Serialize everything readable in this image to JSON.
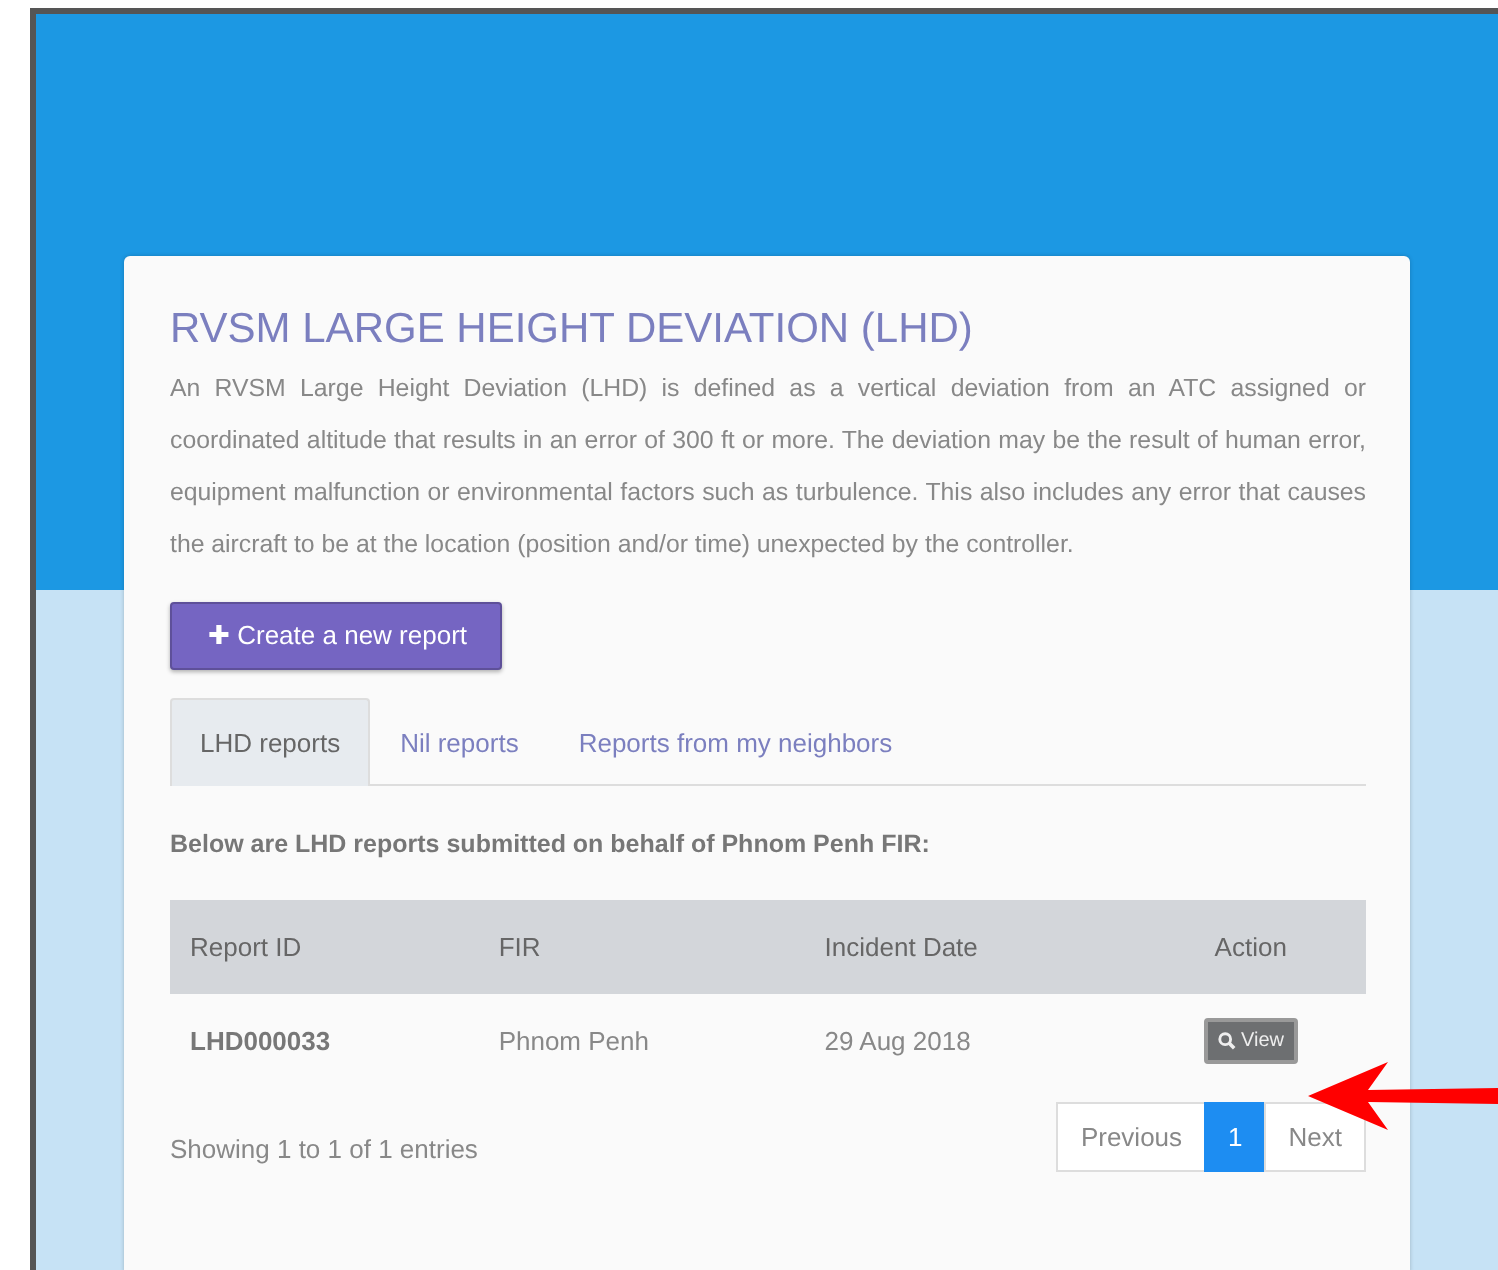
{
  "title": "RVSM LARGE HEIGHT DEVIATION (LHD)",
  "description": "An RVSM Large Height Deviation (LHD) is defined as a vertical deviation from an ATC assigned or coordinated altitude that results in an error of 300 ft or more. The deviation may be the result of human error, equipment malfunction or environmental factors such as turbulence. This also includes any error that causes the aircraft to be at the location (position and/or time) unexpected by the controller.",
  "create_button": {
    "icon": "✚",
    "label": "Create a new report"
  },
  "tabs": [
    {
      "label": "LHD reports",
      "selected": true
    },
    {
      "label": "Nil reports",
      "selected": false
    },
    {
      "label": "Reports from my neighbors",
      "selected": false
    }
  ],
  "intro": "Below are LHD reports submitted on behalf of Phnom Penh FIR:",
  "table": {
    "columns": [
      "Report ID",
      "FIR",
      "Incident Date",
      "Action"
    ],
    "rows": [
      {
        "report_id": "LHD000033",
        "fir": "Phnom Penh",
        "incident_date": "29 Aug 2018",
        "action": "View"
      }
    ]
  },
  "summary": "Showing 1 to 1 of 1 entries",
  "pagination": [
    {
      "label": "Previous",
      "selected": false
    },
    {
      "label": "1",
      "selected": true
    },
    {
      "label": "Next",
      "selected": false
    }
  ]
}
